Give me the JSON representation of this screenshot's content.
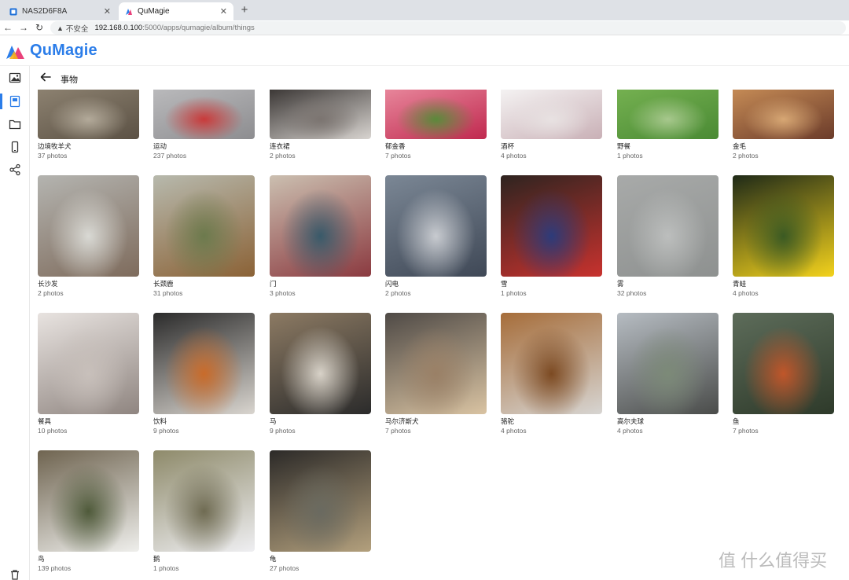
{
  "browser": {
    "tabs": [
      {
        "title": "NAS2D6F8A",
        "active": false
      },
      {
        "title": "QuMagie",
        "active": true
      }
    ],
    "new_tab": "+",
    "insecure_label": "不安全",
    "url_host": "192.168.0.100",
    "url_path": ":5000/apps/qumagie/album/things"
  },
  "app": {
    "name": "QuMagie",
    "brand_color": "#2b7de9"
  },
  "page": {
    "title": "事物",
    "count_suffix": "photos"
  },
  "albums": [
    {
      "label": "边境牧羊犬",
      "count": "37",
      "colors": [
        "#8c8170",
        "#5b5144",
        "#b3aa9a"
      ]
    },
    {
      "label": "运动",
      "count": "237",
      "colors": [
        "#b9b9bb",
        "#8d8d90",
        "#c93a3a"
      ]
    },
    {
      "label": "连衣裙",
      "count": "2",
      "colors": [
        "#3c3836",
        "#d8d4d0",
        "#7b7470"
      ]
    },
    {
      "label": "郁金香",
      "count": "7",
      "colors": [
        "#e7859a",
        "#c0294f",
        "#5a8a3a"
      ]
    },
    {
      "label": "酒杯",
      "count": "4",
      "colors": [
        "#f4f2f2",
        "#c9b0b6",
        "#e8e2e2"
      ]
    },
    {
      "label": "野餐",
      "count": "1",
      "colors": [
        "#74b050",
        "#4a8a34",
        "#a7c88d"
      ]
    },
    {
      "label": "金毛",
      "count": "2",
      "colors": [
        "#c48a55",
        "#6b3b2a",
        "#d7a774"
      ]
    },
    {
      "label": "长沙发",
      "count": "2",
      "colors": [
        "#b4b4b0",
        "#7e6b5c",
        "#d9d9d4"
      ]
    },
    {
      "label": "长颈鹿",
      "count": "31",
      "colors": [
        "#b7b9ad",
        "#8b6236",
        "#6c7a4d"
      ]
    },
    {
      "label": "门",
      "count": "3",
      "colors": [
        "#cbbfb0",
        "#8b3a40",
        "#395a6a"
      ]
    },
    {
      "label": "闪电",
      "count": "2",
      "colors": [
        "#7b8795",
        "#3f4856",
        "#c8cbd0"
      ]
    },
    {
      "label": "雪",
      "count": "1",
      "colors": [
        "#2e2420",
        "#c8322e",
        "#2d3b7a"
      ]
    },
    {
      "label": "雾",
      "count": "32",
      "colors": [
        "#a8aaa9",
        "#8e9190",
        "#bcbebd"
      ]
    },
    {
      "label": "青蛙",
      "count": "4",
      "colors": [
        "#1f2a18",
        "#f3d21c",
        "#3b5a23"
      ]
    },
    {
      "label": "餐具",
      "count": "10",
      "colors": [
        "#e8e3e0",
        "#8f8580",
        "#c8c0bb"
      ]
    },
    {
      "label": "饮料",
      "count": "9",
      "colors": [
        "#2b2b2b",
        "#d9d5cf",
        "#c96b2a"
      ]
    },
    {
      "label": "马",
      "count": "9",
      "colors": [
        "#8c7a63",
        "#2b2b2b",
        "#d8d2c8"
      ]
    },
    {
      "label": "马尔济斯犬",
      "count": "7",
      "colors": [
        "#4f4a46",
        "#d9c3a2",
        "#9a8066"
      ]
    },
    {
      "label": "骆驼",
      "count": "4",
      "colors": [
        "#a66d3a",
        "#d7d5d2",
        "#7c4a22"
      ]
    },
    {
      "label": "高尔夫球",
      "count": "4",
      "colors": [
        "#b6bcc2",
        "#4a4c4a",
        "#7c8a78"
      ]
    },
    {
      "label": "鱼",
      "count": "7",
      "colors": [
        "#5d6c5a",
        "#2e3a2a",
        "#c0562a"
      ]
    },
    {
      "label": "鸟",
      "count": "139",
      "colors": [
        "#6f6450",
        "#efefec",
        "#4f5a3a"
      ]
    },
    {
      "label": "鹅",
      "count": "1",
      "colors": [
        "#8e8a6a",
        "#efeff2",
        "#6f6b52"
      ]
    },
    {
      "label": "龟",
      "count": "27",
      "colors": [
        "#2c2a28",
        "#b3a07d",
        "#6a6a60"
      ]
    }
  ],
  "watermark": "值 什么值得买"
}
